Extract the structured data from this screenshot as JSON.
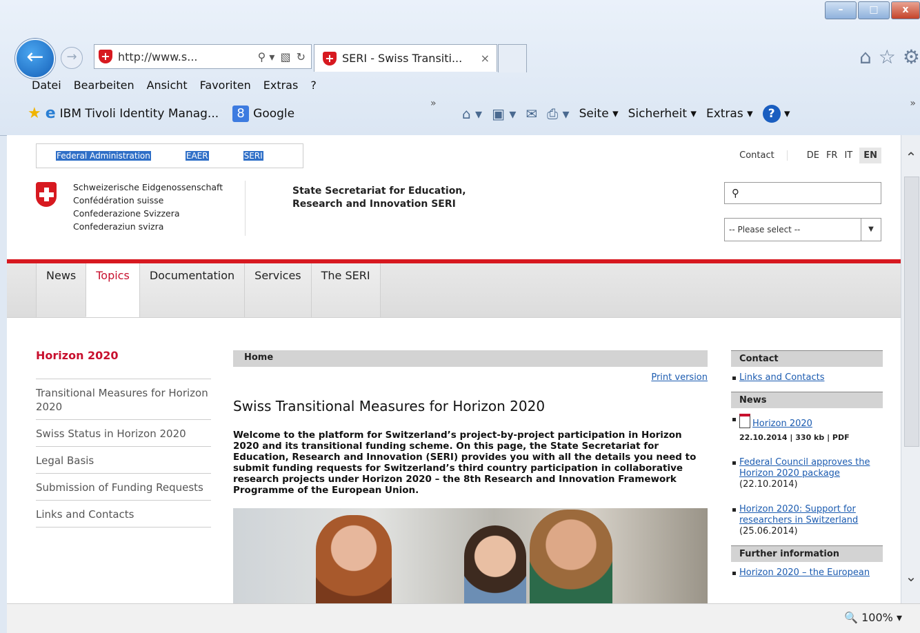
{
  "window": {
    "buttons": [
      "–",
      "□",
      "x"
    ]
  },
  "browser": {
    "address": "http://www.s...",
    "tab_title": "SERI - Swiss Transiti...",
    "tab_close": "×",
    "menu": [
      "Datei",
      "Bearbeiten",
      "Ansicht",
      "Favoriten",
      "Extras",
      "?"
    ],
    "favorites": {
      "item1": "IBM Tivoli Identity Manag...",
      "item2": "Google"
    },
    "commands": {
      "page": "Seite ▾",
      "safety": "Sicherheit ▾",
      "tools": "Extras ▾"
    },
    "zoom": "100%"
  },
  "page": {
    "breadcrumb": [
      "Federal Administration",
      "EAER",
      "SERI"
    ],
    "contact": "Contact",
    "languages": [
      "DE",
      "FR",
      "IT",
      "EN"
    ],
    "confederation": [
      "Schweizerische Eidgenossenschaft",
      "Confédération suisse",
      "Confederazione Svizzera",
      "Confederaziun svizra"
    ],
    "org_line1": "State Secretariat for Education,",
    "org_line2": "Research and Innovation SERI",
    "search_icon": "search-icon",
    "select_placeholder": "-- Please select --",
    "nav": [
      "News",
      "Topics",
      "Documentation",
      "Services",
      "The SERI"
    ],
    "left": {
      "title": "Horizon 2020",
      "items": [
        "Transitional Measures for Horizon 2020",
        "Swiss Status in Horizon 2020",
        "Legal Basis",
        "Submission of Funding Requests",
        "Links and Contacts"
      ]
    },
    "main": {
      "home": "Home",
      "print": "Print version",
      "heading": "Swiss Transitional Measures for Horizon 2020",
      "lead": "Welcome to the platform for Switzerland’s project-by-project participation in Horizon 2020 and its transitional funding scheme. On this page, the State Secretariat for Education, Research and Innovation (SERI) provides you with all the details you need to submit funding requests for Switzerland’s third country participation in collaborative research projects under Horizon 2020 – the 8th Research and Innovation Framework Programme of the European Union."
    },
    "right": {
      "contact_head": "Contact",
      "contact_link": "Links and Contacts",
      "news_head": "News",
      "news1_link": "Horizon 2020",
      "news1_meta": "22.10.2014 | 330 kb | PDF",
      "news2_link": "Federal Council approves the Horizon 2020 package",
      "news2_date": "(22.10.2014)",
      "news3_link": "Horizon 2020: Support for researchers in Switzerland",
      "news3_date": "(25.06.2014)",
      "further_head": "Further information",
      "further_link": "Horizon 2020 – the European"
    }
  }
}
